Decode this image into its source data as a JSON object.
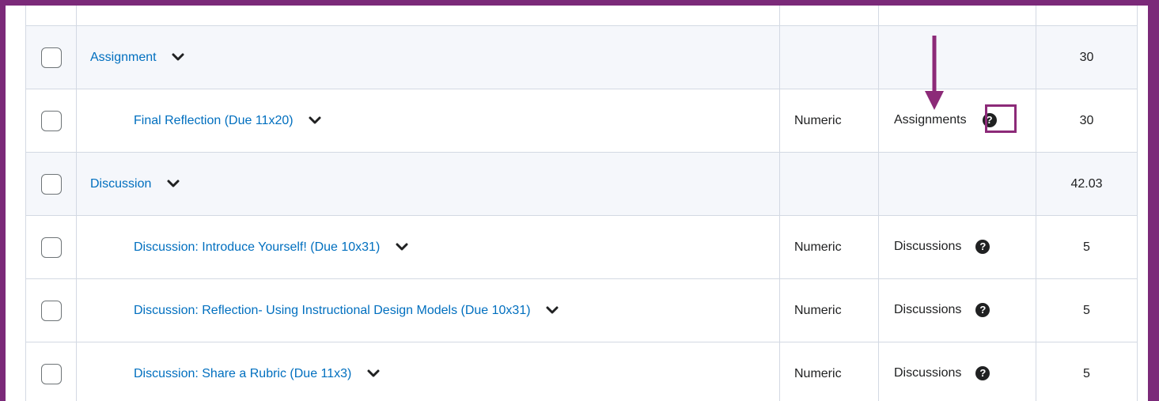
{
  "rows": [
    {
      "name": "Assignment",
      "grade_type": "",
      "tool": "",
      "points": "30"
    },
    {
      "name": "Final Reflection (Due 11x20)",
      "grade_type": "Numeric",
      "tool": "Assignments",
      "points": "30"
    },
    {
      "name": "Discussion",
      "grade_type": "",
      "tool": "",
      "points": "42.03"
    },
    {
      "name": "Discussion: Introduce Yourself! (Due 10x31)",
      "grade_type": "Numeric",
      "tool": "Discussions",
      "points": "5"
    },
    {
      "name": "Discussion: Reflection- Using Instructional Design Models (Due 10x31)",
      "grade_type": "Numeric",
      "tool": "Discussions",
      "points": "5"
    },
    {
      "name": "Discussion: Share a Rubric (Due 11x3)",
      "grade_type": "Numeric",
      "tool": "Discussions",
      "points": "5"
    }
  ],
  "icons": {
    "expand": "chevron-down-icon",
    "help": "question-circle-icon",
    "help_glyph": "?",
    "annotation": "arrow-down-icon"
  },
  "colors": {
    "frame": "#7b2a79",
    "annotation": "#8c2a78",
    "link": "#006fbf",
    "category_row": "#f5f7fb"
  }
}
